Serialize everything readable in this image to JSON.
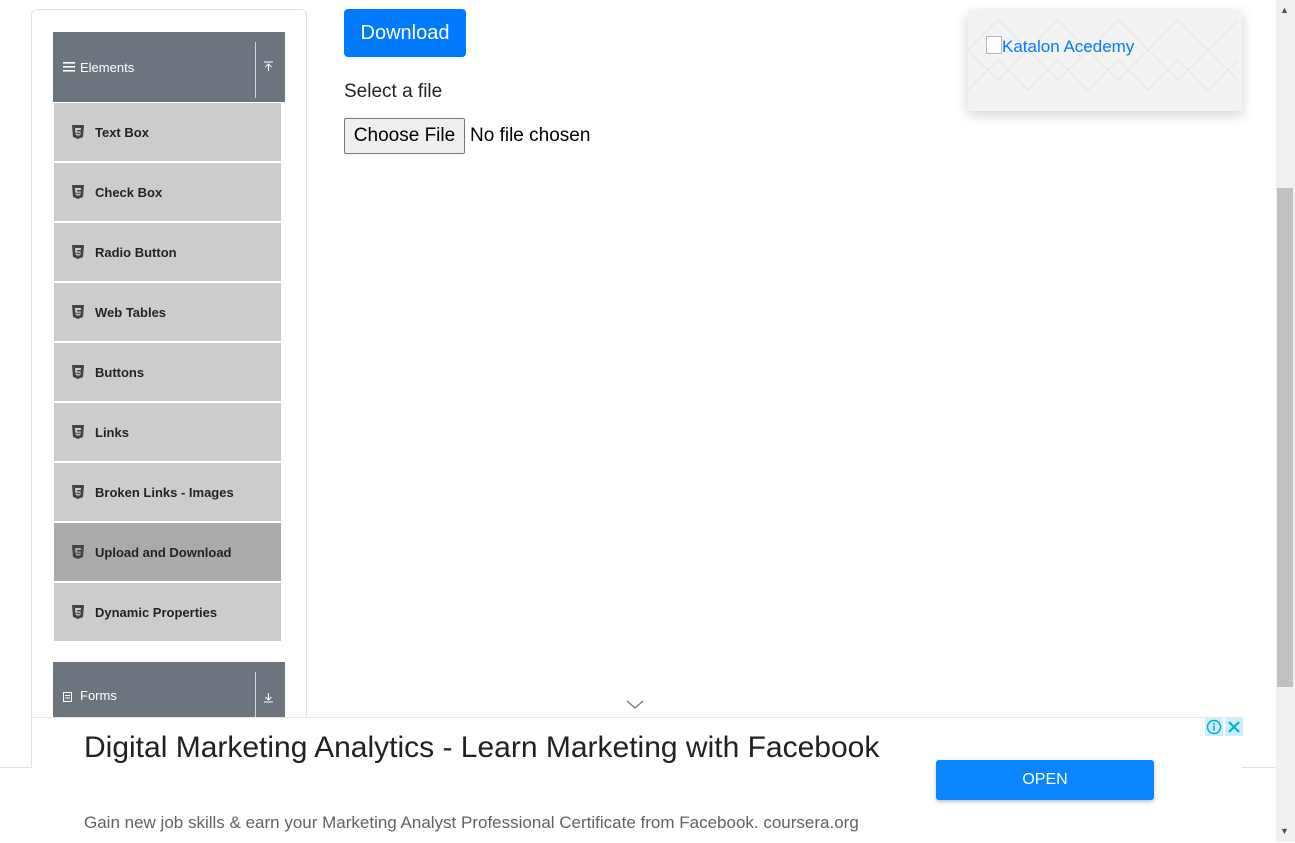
{
  "sidebar": {
    "elements_header": {
      "label": "Elements",
      "icon": "hamburger-icon",
      "arrow": "collapse-arrow-icon"
    },
    "items": [
      {
        "label": "Text Box"
      },
      {
        "label": "Check Box"
      },
      {
        "label": "Radio Button"
      },
      {
        "label": "Web Tables"
      },
      {
        "label": "Buttons"
      },
      {
        "label": "Links"
      },
      {
        "label": "Broken Links - Images"
      },
      {
        "label": "Upload and Download",
        "active": true
      },
      {
        "label": "Dynamic Properties"
      }
    ],
    "forms_header": {
      "label": "Forms",
      "icon": "form-icon",
      "arrow": "expand-arrow-icon"
    }
  },
  "main": {
    "download_label": "Download",
    "select_label": "Select a file",
    "choose_label": "Choose File",
    "file_status": "No file chosen"
  },
  "ad_top": {
    "alt_text": "Katalon Acedemy"
  },
  "ad_bottom": {
    "title": "Digital Marketing Analytics - Learn Marketing with Facebook",
    "subtitle": "Gain new job skills & earn your Marketing Analyst Professional Certificate from Facebook. coursera.org",
    "open_label": "OPEN"
  },
  "colors": {
    "primary": "#007bff",
    "header_bg": "#6c757d",
    "item_bg": "#cccccc",
    "active_bg": "#aaaaaa"
  }
}
